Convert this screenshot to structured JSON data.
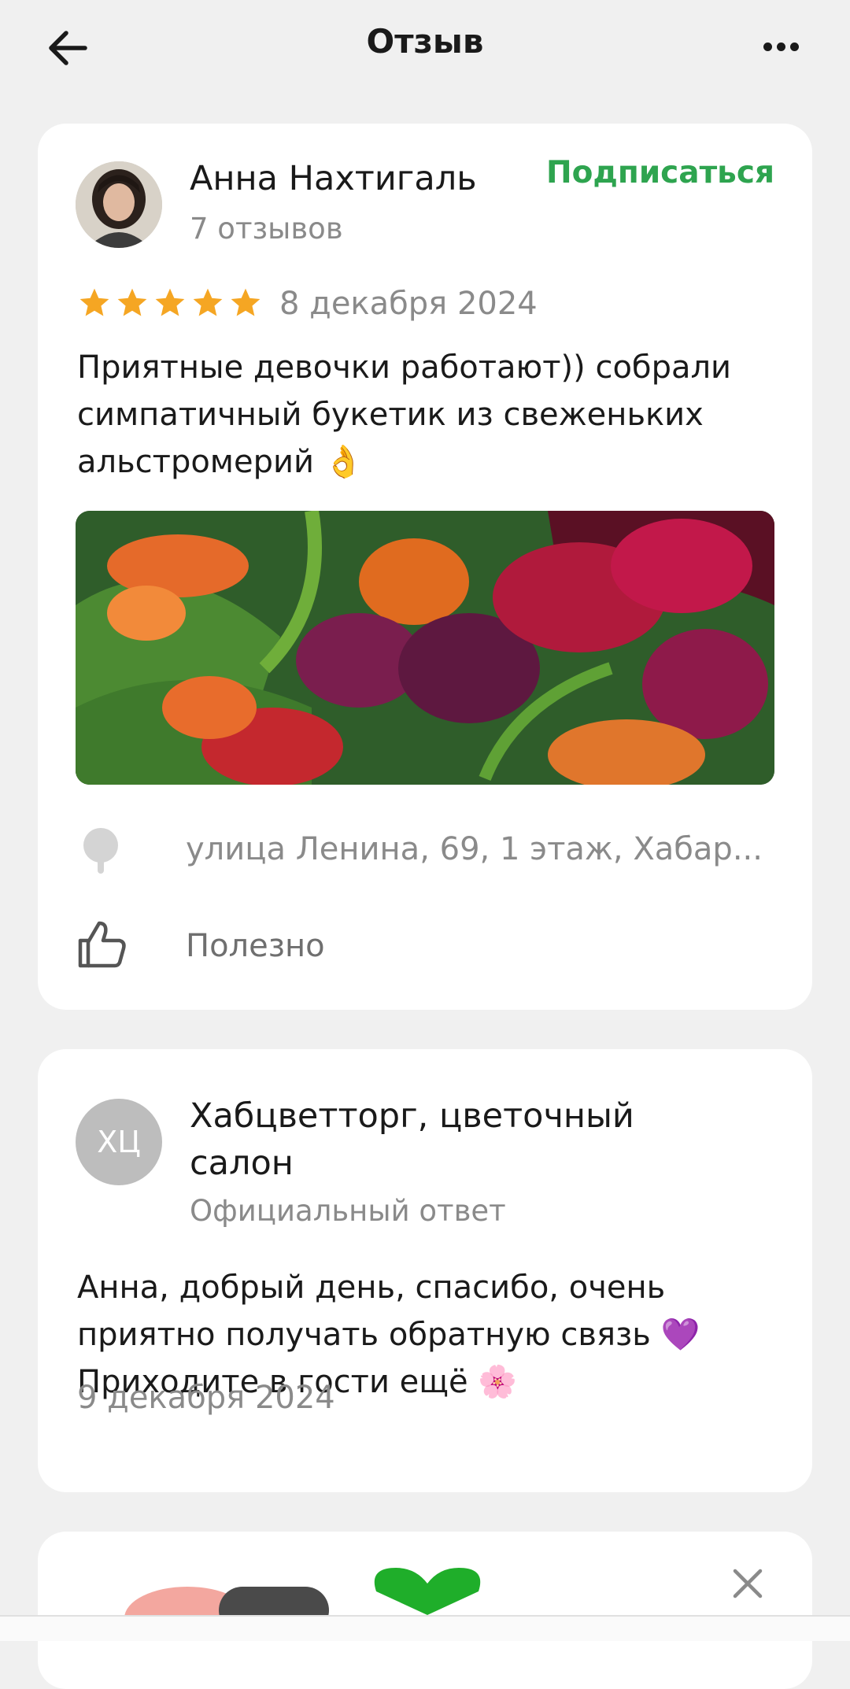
{
  "header": {
    "title": "Отзыв"
  },
  "review": {
    "author_name": "Анна Нахтигаль",
    "author_reviews": "7 отзывов",
    "subscribe_label": "Подписаться",
    "rating": 5,
    "date": "8 декабря 2024",
    "text": "Приятные девочки работают)) собрали симпатичный букетик из свеженьких альстромерий 👌",
    "address": "улица Ленина, 69, 1 этаж, Хабар...",
    "useful_label": "Полезно"
  },
  "reply": {
    "avatar_initials": "ХЦ",
    "org_name": "Хабцветторг, цветочный салон",
    "subtitle": "Официальный ответ",
    "text": "Анна, добрый день, спасибо, очень приятно получать обратную связь 💜 Приходите в гости ещё 🌸",
    "date": "9 декабря 2024"
  },
  "colors": {
    "accent_green": "#2ea44f",
    "star": "#f5a623",
    "muted_text": "#8a8a8a",
    "background": "#f0f0f0"
  },
  "icons": [
    "back-arrow-icon",
    "more-dots-icon",
    "star-icon",
    "map-pin-icon",
    "thumbs-up-icon",
    "close-icon"
  ]
}
